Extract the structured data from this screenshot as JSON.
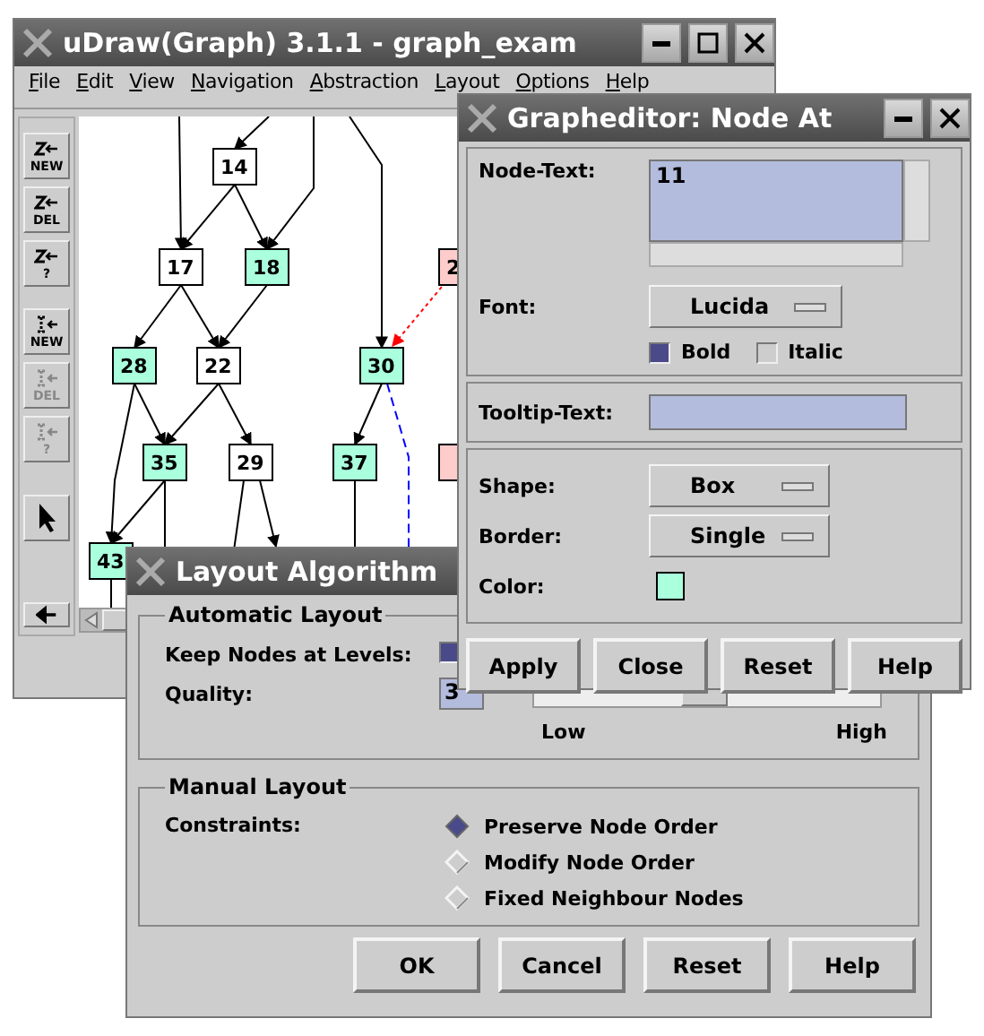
{
  "main_window": {
    "title": "uDraw(Graph) 3.1.1 - graph_exam",
    "menu": [
      "File",
      "Edit",
      "View",
      "Navigation",
      "Abstraction",
      "Layout",
      "Options",
      "Help"
    ],
    "tools": [
      {
        "kind": "edge",
        "caption": "NEW",
        "disabled": false
      },
      {
        "kind": "edge",
        "caption": "DEL",
        "disabled": false
      },
      {
        "kind": "edge",
        "caption": "?",
        "disabled": false
      },
      {
        "kind": "node",
        "caption": "NEW",
        "disabled": false
      },
      {
        "kind": "node",
        "caption": "DEL",
        "disabled": true
      },
      {
        "kind": "node",
        "caption": "?",
        "disabled": true
      },
      {
        "kind": "pointer",
        "disabled": false
      }
    ],
    "graph": {
      "nodes": [
        {
          "label": "14",
          "color": "#ffffff"
        },
        {
          "label": "17",
          "color": "#ffffff"
        },
        {
          "label": "18",
          "color": "#aaffdd"
        },
        {
          "label": "2",
          "color": "#ffcccc"
        },
        {
          "label": "28",
          "color": "#aaffdd"
        },
        {
          "label": "22",
          "color": "#ffffff"
        },
        {
          "label": "30",
          "color": "#aaffdd"
        },
        {
          "label": "35",
          "color": "#aaffdd"
        },
        {
          "label": "29",
          "color": "#ffffff"
        },
        {
          "label": "37",
          "color": "#aaffdd"
        },
        {
          "color": "#ffcccc"
        },
        {
          "label": "43",
          "color": "#aaffdd"
        }
      ]
    }
  },
  "layout_dialog": {
    "title": "Layout Algorithm",
    "automatic": {
      "legend": "Automatic Layout",
      "keep_levels": {
        "label": "Keep Nodes at Levels:",
        "checked": true
      },
      "quality": {
        "label": "Quality:",
        "value": "3",
        "level": 0.49,
        "low_label": "Low",
        "high_label": "High"
      }
    },
    "manual": {
      "legend": "Manual Layout",
      "label": "Constraints:",
      "options": [
        {
          "label": "Preserve Node Order",
          "selected": true
        },
        {
          "label": "Modify Node Order",
          "selected": false
        },
        {
          "label": "Fixed Neighbour Nodes",
          "selected": false
        }
      ]
    },
    "buttons": [
      "OK",
      "Cancel",
      "Reset",
      "Help"
    ]
  },
  "node_editor": {
    "title": "Grapheditor: Node At",
    "node_text": {
      "label": "Node-Text:",
      "value": "11"
    },
    "font": {
      "label": "Font:",
      "value": "Lucida"
    },
    "bold": {
      "label": "Bold",
      "checked": true
    },
    "italic": {
      "label": "Italic",
      "checked": false
    },
    "tooltip": {
      "label": "Tooltip-Text:"
    },
    "shape": {
      "label": "Shape:",
      "value": "Box"
    },
    "border": {
      "label": "Border:",
      "value": "Single"
    },
    "color": {
      "label": "Color:",
      "color": "#aaffdd"
    },
    "buttons": [
      "Apply",
      "Close",
      "Reset",
      "Help"
    ]
  }
}
